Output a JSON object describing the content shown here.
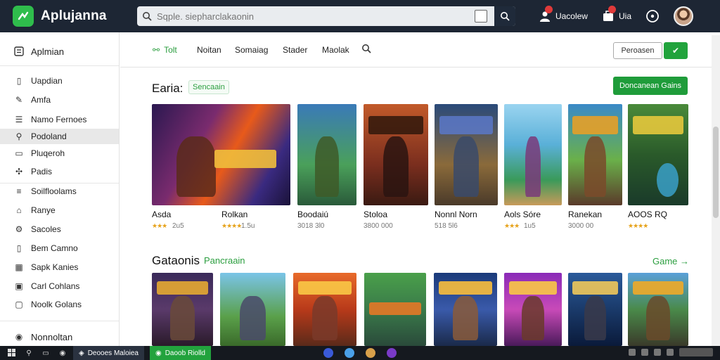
{
  "app": {
    "name": "Aplujanna"
  },
  "search": {
    "placeholder": "Sqple. siepharclakaonin"
  },
  "top_actions": [
    {
      "label": "Uacolew"
    },
    {
      "label": "Uia"
    }
  ],
  "sidebar": {
    "header": "Aplmian",
    "items": [
      {
        "label": "Uapdian"
      },
      {
        "label": "Amfa"
      },
      {
        "label": "Namo Fernoes"
      },
      {
        "label": "Podoland",
        "active": true
      },
      {
        "label": "Pluqeroh"
      },
      {
        "label": "Padis"
      },
      {
        "label": "Soilfloolams"
      },
      {
        "label": "Ranye"
      },
      {
        "label": "Sacoles"
      },
      {
        "label": "Bem Camno"
      },
      {
        "label": "Sapk Kanies"
      },
      {
        "label": "Carl Cohlans"
      },
      {
        "label": "Noolk Golans"
      }
    ],
    "footer": "Nonnoltan"
  },
  "nav": {
    "tabs": [
      {
        "label": "Tolt",
        "active": true
      },
      {
        "label": "Noitan"
      },
      {
        "label": "Somaiag"
      },
      {
        "label": "Stader"
      },
      {
        "label": "Maolak"
      }
    ],
    "outline_button": "Peroasen",
    "green_button": "✔"
  },
  "section1": {
    "title": "Earia:",
    "chip": "Sencaain",
    "button": "Doncanean Gains",
    "cards": [
      {
        "title": "Asda",
        "sub": "2u5",
        "stars": "★★★"
      },
      {
        "title": "Rolkan",
        "sub": "1.5u",
        "stars": "★★★★"
      },
      {
        "title": "Boodaiú",
        "sub": "3018 3l0"
      },
      {
        "title": "Stoloa",
        "sub": "3800 000"
      },
      {
        "title": "Nonnl Norn",
        "sub": "518 5l6"
      },
      {
        "title": "Aols Sóre",
        "sub": "1u5",
        "stars": "★★★"
      },
      {
        "title": "Ranekan",
        "sub": "3000 00"
      },
      {
        "title": "AOOS RQ",
        "stars": "★★★★"
      }
    ]
  },
  "section2": {
    "title": "Gataonis",
    "chip": "Pancraain",
    "link": "Game →"
  },
  "taskbar": {
    "tasks": [
      {
        "label": "Deooes Maloiea",
        "active": false
      },
      {
        "label": "Daoob Riolld",
        "active": true
      }
    ]
  }
}
